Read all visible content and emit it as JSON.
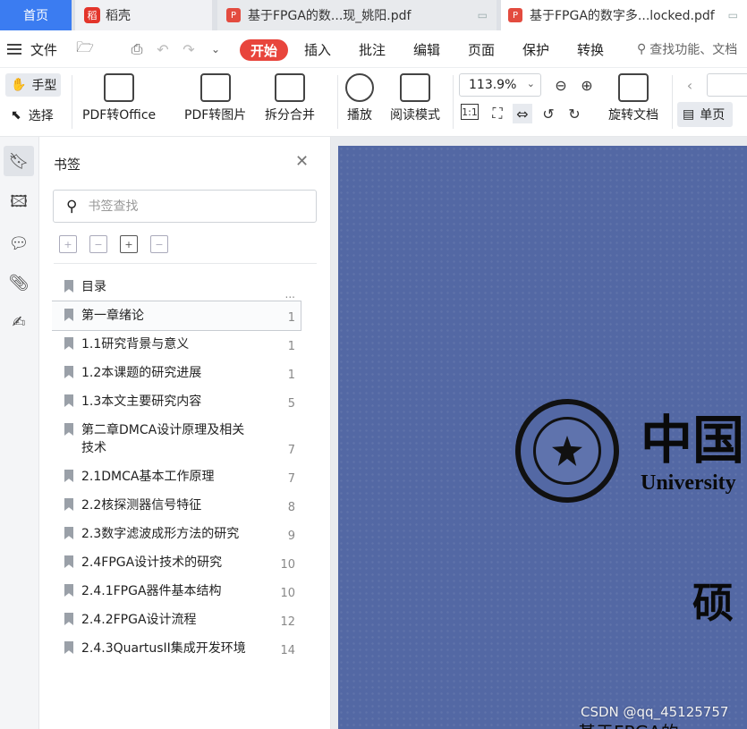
{
  "tabs": {
    "home": "首页",
    "daoke": "稻壳",
    "pdf1": "基于FPGA的数...现_姚阳.pdf",
    "pdf2": "基于FPGA的数字多...locked.pdf"
  },
  "menu": {
    "file": "文件",
    "start": "开始",
    "insert": "插入",
    "annotate": "批注",
    "edit": "编辑",
    "page": "页面",
    "protect": "保护",
    "convert": "转换",
    "search_hint": "查找功能、文档"
  },
  "toolbar": {
    "hand": "手型",
    "select": "选择",
    "pdf_to_office": "PDF转Office",
    "pdf_to_image": "PDF转图片",
    "split_merge": "拆分合并",
    "play": "播放",
    "read_mode": "阅读模式",
    "zoom": "113.9%",
    "rotate_doc": "旋转文档",
    "single_page": "单页"
  },
  "panel": {
    "title": "书签",
    "search_placeholder": "书签查找",
    "more": "...",
    "items": [
      {
        "label": "目录",
        "page": ""
      },
      {
        "label": "第一章绪论",
        "page": "1"
      },
      {
        "label": "1.1研究背景与意义",
        "page": "1"
      },
      {
        "label": "1.2本课题的研究进展",
        "page": "1"
      },
      {
        "label": "1.3本文主要研究内容",
        "page": "5"
      },
      {
        "label": "第二章DMCA设计原理及相关技术",
        "page": "7"
      },
      {
        "label": "2.1DMCA基本工作原理",
        "page": "7"
      },
      {
        "label": "2.2核探测器信号特征",
        "page": "8"
      },
      {
        "label": "2.3数字滤波成形方法的研究",
        "page": "9"
      },
      {
        "label": "2.4FPGA设计技术的研究",
        "page": "10"
      },
      {
        "label": "2.4.1FPGA器件基本结构",
        "page": "10"
      },
      {
        "label": "2.4.2FPGA设计流程",
        "page": "12"
      },
      {
        "label": "2.4.3QuartusII集成开发环境",
        "page": "14"
      }
    ]
  },
  "document": {
    "university_cn": "中国",
    "university_en": "University",
    "degree": "硕",
    "bottom_title": "基于FPGA的"
  },
  "watermark": "CSDN @qq_45125757"
}
